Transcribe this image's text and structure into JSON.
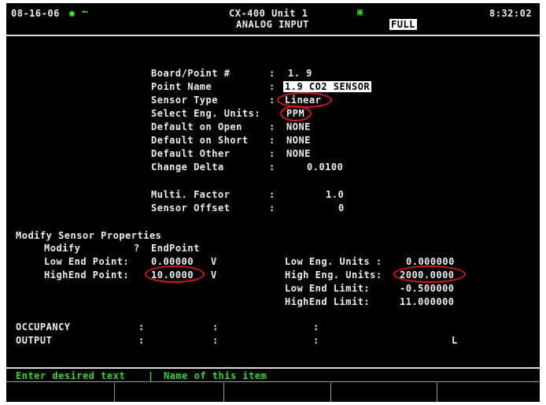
{
  "header": {
    "date": "08-16-06",
    "device": "CX-400 Unit 1",
    "screen_title": "ANALOG INPUT",
    "mode": "FULL",
    "time": "8:32:02"
  },
  "fields": {
    "board_point": {
      "label": "Board/Point #",
      "sep": ":",
      "value": "1. 9"
    },
    "point_name": {
      "label": "Point Name",
      "sep": ":",
      "value": "1.9 CO2 SENSOR"
    },
    "sensor_type": {
      "label": "Sensor Type",
      "sep": ":",
      "value": "Linear"
    },
    "eng_units": {
      "label": "Select Eng. Units:",
      "value": "PPM"
    },
    "default_open": {
      "label": "Default on Open",
      "sep": ":",
      "value": "NONE"
    },
    "default_short": {
      "label": "Default on Short",
      "sep": ":",
      "value": "NONE"
    },
    "default_other": {
      "label": "Default Other",
      "sep": ":",
      "value": "NONE"
    },
    "change_delta": {
      "label": "Change Delta",
      "sep": ":",
      "value": "0.0100"
    },
    "multi_factor": {
      "label": "Multi. Factor",
      "sep": ":",
      "value": "1.0"
    },
    "sensor_offset": {
      "label": "Sensor Offset",
      "sep": ":",
      "value": "0"
    }
  },
  "properties": {
    "heading": "Modify Sensor Properties",
    "modify_label": "Modify",
    "modify_q": "?",
    "modify_value": "EndPoint",
    "low_end_label": "Low End Point:",
    "low_end_value": "0.00000",
    "low_end_unit": "V",
    "high_end_label": "HighEnd Point:",
    "high_end_value": "10.0000",
    "high_end_unit": "V",
    "low_eng_label": "Low Eng. Units :",
    "low_eng_value": "0.000000",
    "high_eng_label": "High Eng. Units:",
    "high_eng_value": "2000.0000",
    "low_limit_label": "Low End Limit:",
    "low_limit_value": "-0.500000",
    "high_limit_label": "HighEnd Limit:",
    "high_limit_value": "11.000000"
  },
  "footer_rows": {
    "occupancy_label": "OCCUPANCY",
    "output_label": "OUTPUT",
    "colon": ":",
    "output_value": "L"
  },
  "status_bar": {
    "prompt": "Enter desired text",
    "separator": "|",
    "hint": "Name of this item"
  },
  "colors": {
    "highlight_circle": "#d21a1a",
    "status_text": "#35d635",
    "selected_bg": "#ffffff"
  }
}
